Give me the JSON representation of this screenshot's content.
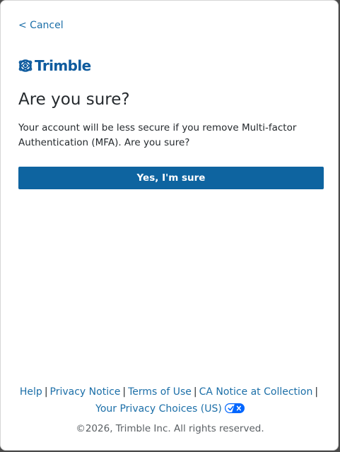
{
  "header": {
    "cancel_label": "< Cancel"
  },
  "brand": {
    "logo_text": "Trimble",
    "logo_color": "#0e5b9e"
  },
  "main": {
    "title": "Are you sure?",
    "message": "Your account will be less secure if you remove Multi-factor Authentication (MFA). Are you sure?",
    "confirm_label": "Yes, I'm sure",
    "accent_color": "#0e64a0"
  },
  "footer": {
    "links": [
      {
        "label": "Help"
      },
      {
        "label": "Privacy Notice"
      },
      {
        "label": "Terms of Use"
      },
      {
        "label": "CA Notice at Collection"
      }
    ],
    "separator": "|",
    "privacy_choices_label": "Your Privacy Choices (US)",
    "privacy_choices_icon": "privacy-options-toggle-icon",
    "copyright": "©2026, Trimble Inc. All rights reserved."
  }
}
